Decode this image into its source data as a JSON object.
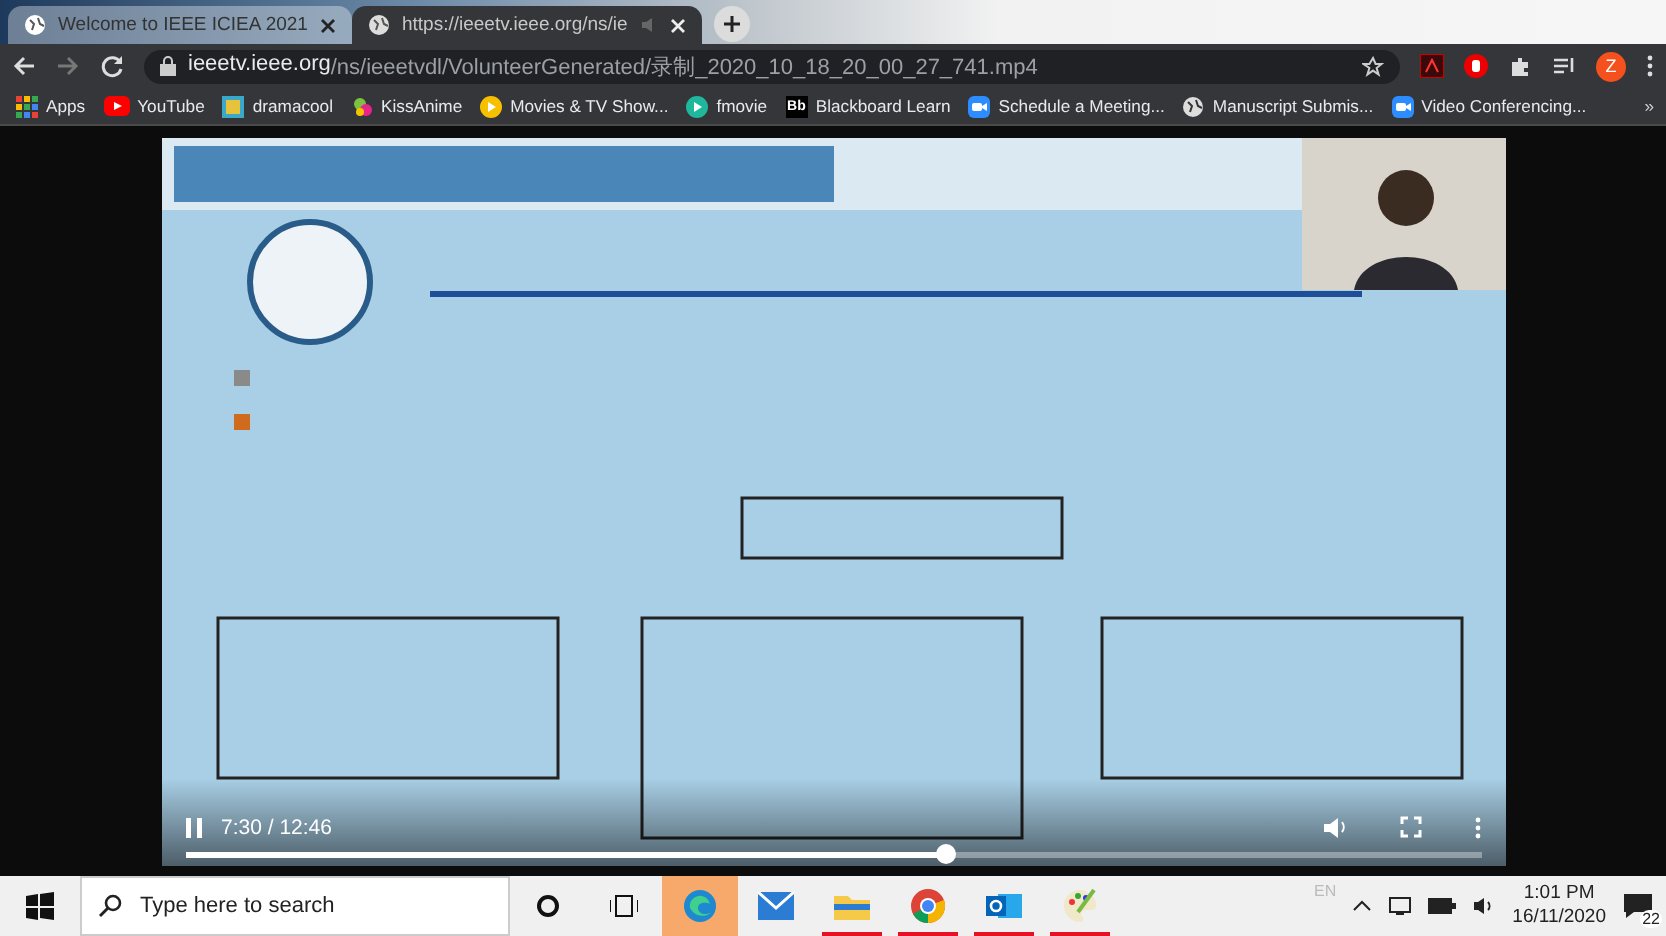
{
  "tabs": [
    {
      "title": "Welcome to IEEE ICIEA 2021",
      "selected": false,
      "audio": false
    },
    {
      "title": "https://ieeetv.ieee.org/ns/ie",
      "selected": true,
      "audio": true
    }
  ],
  "address_bar": {
    "host": "ieeetv.ieee.org",
    "path": "/ns/ieeetvdl/VolunteerGenerated/录制_2020_10_18_20_00_27_741.mp4",
    "profile": "Z"
  },
  "bookmarks": [
    {
      "label": "Apps",
      "kind": "apps"
    },
    {
      "label": "YouTube",
      "kind": "youtube"
    },
    {
      "label": "dramacool",
      "kind": "square"
    },
    {
      "label": "KissAnime",
      "kind": "flower"
    },
    {
      "label": "Movies & TV Show...",
      "kind": "play-yellow"
    },
    {
      "label": "fmovie",
      "kind": "play-teal"
    },
    {
      "label": "Blackboard Learn",
      "kind": "bb",
      "badge": "Bb"
    },
    {
      "label": "Schedule a Meeting...",
      "kind": "camera"
    },
    {
      "label": "Manuscript Submis...",
      "kind": "globe"
    },
    {
      "label": "Video Conferencing...",
      "kind": "camera"
    }
  ],
  "bookmarks_more": "»",
  "video": {
    "kind": "picture",
    "time": "7:30 / 12:46",
    "level": 0.587,
    "playing": true
  },
  "taskbar": {
    "search_placeholder": "Type here to search",
    "apps": [
      {
        "kind": "edge",
        "running": false,
        "active": true
      },
      {
        "kind": "mail",
        "running": false,
        "active": false
      },
      {
        "kind": "folder",
        "running": true,
        "active": false
      },
      {
        "kind": "chrome",
        "running": true,
        "active": false
      },
      {
        "kind": "outlook",
        "running": true,
        "active": false
      },
      {
        "kind": "paint",
        "running": true,
        "active": false
      }
    ],
    "language": "EN",
    "time": "1:01 PM",
    "date": "16/11/2020",
    "notifications": "22"
  }
}
